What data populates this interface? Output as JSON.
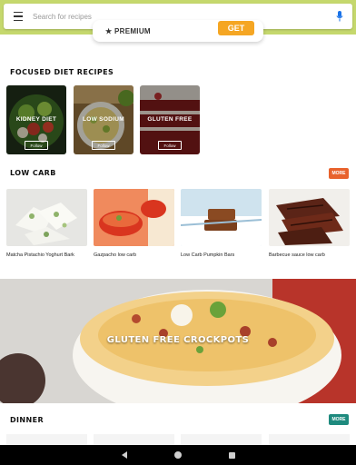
{
  "search": {
    "placeholder": "Search for recipes"
  },
  "premium": {
    "label": "★ PREMIUM",
    "button": "GET"
  },
  "focused": {
    "title": "FOCUSED DIET RECIPES",
    "follow_label": "Follow",
    "tiles": [
      {
        "name": "KIDNEY DIET"
      },
      {
        "name": "LOW SODIUM"
      },
      {
        "name": "GLUTEN FREE"
      }
    ]
  },
  "low_carb": {
    "title": "LOW CARB",
    "more": "MORE",
    "more_color": "#e8622c",
    "items": [
      {
        "name": "Matcha Pistachio Yoghurt Bark"
      },
      {
        "name": "Gazpacho low carb"
      },
      {
        "name": "Low Carb Pumpkin Bars"
      },
      {
        "name": "Barbecue sauce low carb"
      }
    ]
  },
  "banner": {
    "title": "GLUTEN FREE CROCKPOTS"
  },
  "dinner": {
    "title": "DINNER",
    "more": "MORE",
    "more_color": "#1e8a7e"
  },
  "theme": {
    "topbar": "#c5d86d",
    "accent": "#f5a623"
  },
  "icons": {
    "menu": "hamburger-menu-icon",
    "mic": "microphone-icon",
    "back": "back-triangle-icon",
    "home": "home-circle-icon",
    "recent": "recent-square-icon"
  }
}
